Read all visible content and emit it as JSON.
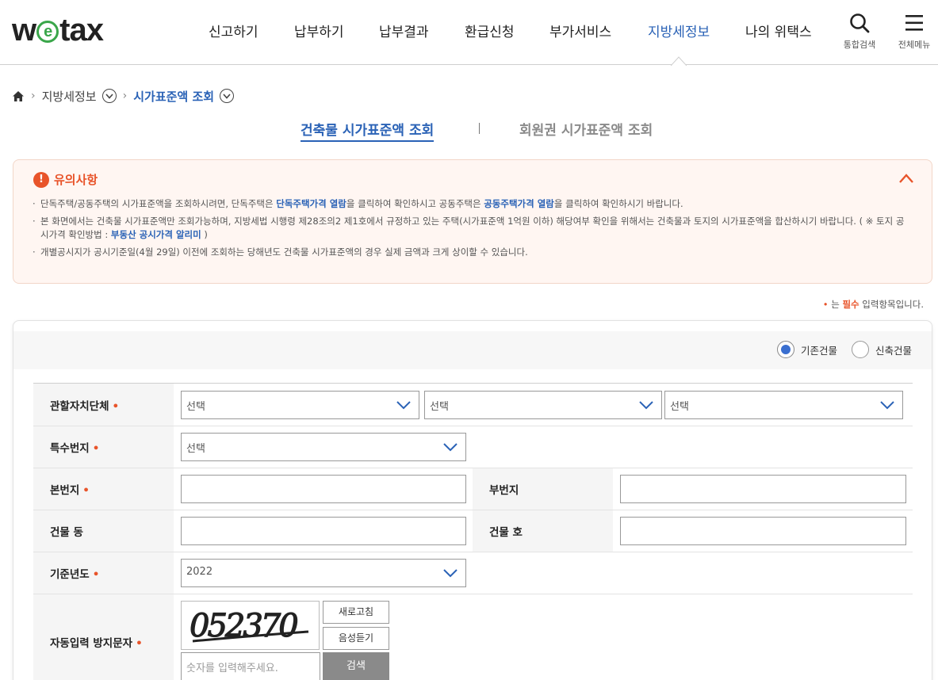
{
  "header": {
    "logo_prefix": "w",
    "logo_e": "e",
    "logo_suffix": "tax",
    "nav": [
      "신고하기",
      "납부하기",
      "납부결과",
      "환급신청",
      "부가서비스",
      "지방세정보",
      "나의 위택스"
    ],
    "active_nav": "지방세정보",
    "search_label": "통합검색",
    "menu_label": "전체메뉴"
  },
  "breadcrumb": {
    "level1": "지방세정보",
    "level2": "시가표준액 조회"
  },
  "subtabs": {
    "active": "건축물 시가표준액 조회",
    "inactive": "회원권 시가표준액 조회"
  },
  "notice": {
    "title": "유의사항",
    "line1_a": "단독주택/공동주택의 시가표준액을 조회하시려면, 단독주택은 ",
    "line1_link1": "단독주택가격 열람",
    "line1_b": "을 클릭하여 확인하시고 공동주택은 ",
    "line1_link2": "공동주택가격 열람",
    "line1_c": "을 클릭하여 확인하시기 바랍니다.",
    "line2_a": "본 화면에서는 건축물 시가표준액만 조회가능하며, 지방세법 시행령 제28조의2 제1호에서 규정하고 있는 주택(시가표준액 1억원 이하) 해당여부 확인을 위해서는 건축물과 토지의 시가표준액을 합산하시기 바랍니다. ( ※ 토지 공시가격 확인방법 : ",
    "line2_link": "부동산 공시가격 알리미",
    "line2_b": " )",
    "line3": "개별공시지가 공시기준일(4월 29일) 이전에 조회하는 당해년도 건축물 시가표준액의 경우 실제 금액과 크게 상이할 수 있습니다."
  },
  "required_note": {
    "dot": "•",
    "prefix": " 는 ",
    "req": "필수",
    "suffix": " 입력항목입니다."
  },
  "form": {
    "building_type": {
      "existing": "기존건물",
      "new": "신축건물",
      "selected": "기존건물"
    },
    "local_gov_label": "관할자치단체",
    "local_gov_selects": [
      "선택",
      "선택",
      "선택"
    ],
    "special_lot_label": "특수번지",
    "special_lot_value": "선택",
    "main_lot_label": "본번지",
    "main_lot_value": "",
    "sub_lot_label": "부번지",
    "sub_lot_value": "",
    "building_dong_label": "건물 동",
    "building_dong_value": "",
    "building_ho_label": "건물 호",
    "building_ho_value": "",
    "base_year_label": "기준년도",
    "base_year_value": "2022",
    "captcha_label": "자동입력 방지문자",
    "captcha_text": "052370",
    "refresh_label": "새로고침",
    "audio_label": "음성듣기",
    "captcha_placeholder": "숫자를 입력해주세요.",
    "search_label": "검색"
  },
  "colors": {
    "accent_blue": "#2a62b6",
    "warning_orange": "#e8542a",
    "radio_blue": "#3a6fd0",
    "logo_green": "#3aa64a"
  }
}
